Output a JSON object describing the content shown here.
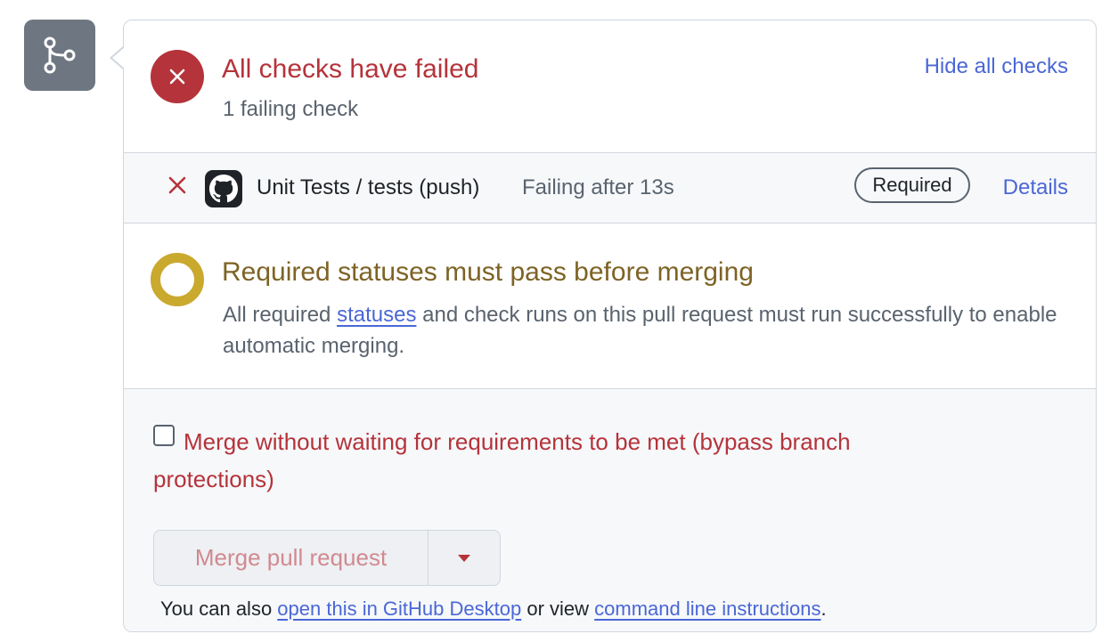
{
  "checks_header": {
    "title": "All checks have failed",
    "subtitle": "1 failing check",
    "toggle_link": "Hide all checks",
    "status_color": "#b5333a",
    "icon": "x-icon"
  },
  "check_run": {
    "name": "Unit Tests / tests (push)",
    "status": "Failing after 13s",
    "badge": "Required",
    "details_link": "Details",
    "app_icon": "github-logo-icon"
  },
  "requirements": {
    "title": "Required statuses must pass before merging",
    "desc_before": "All required ",
    "desc_link": "statuses",
    "desc_after": " and check runs on this pull request must run successfully to enable automatic merging.",
    "status_color": "#c9a92e"
  },
  "merge": {
    "bypass_label": "Merge without waiting for requirements to be met (bypass branch protections)",
    "bypass_checked": false,
    "button_label": "Merge pull request",
    "also_prefix": "You can also ",
    "desktop_link": "open this in GitHub Desktop",
    "also_middle": " or view ",
    "cli_link": "command line instructions",
    "also_suffix": "."
  },
  "timeline_icon": "git-branch-icon"
}
